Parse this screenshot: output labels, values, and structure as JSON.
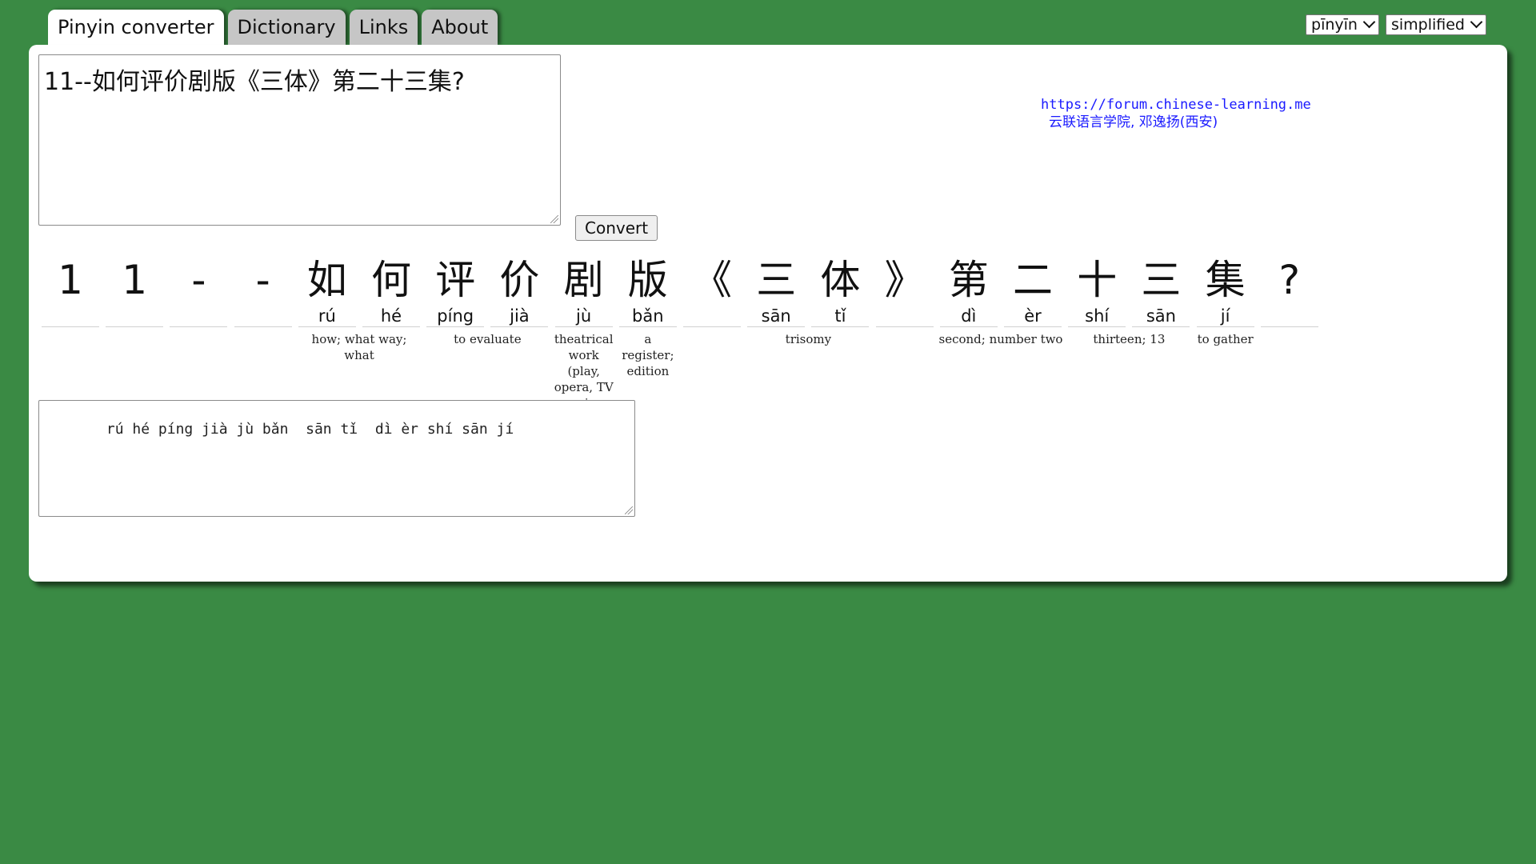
{
  "tabs": [
    {
      "label": "Pinyin converter",
      "active": true
    },
    {
      "label": "Dictionary",
      "active": false
    },
    {
      "label": "Links",
      "active": false
    },
    {
      "label": "About",
      "active": false
    }
  ],
  "selects": {
    "mode": "pīnyīn",
    "script": "simplified"
  },
  "input_text": "11--如何评价剧版《三体》第二十三集?",
  "convert_label": "Convert",
  "credit": {
    "url": "https://forum.chinese-learning.me",
    "org": "云联语言学院, 邓逸扬(西安)"
  },
  "chars": [
    {
      "hanzi": "1",
      "pinyin": ""
    },
    {
      "hanzi": "1",
      "pinyin": ""
    },
    {
      "hanzi": "-",
      "pinyin": ""
    },
    {
      "hanzi": "-",
      "pinyin": ""
    },
    {
      "hanzi": "如",
      "pinyin": "rú"
    },
    {
      "hanzi": "何",
      "pinyin": "hé"
    },
    {
      "hanzi": "评",
      "pinyin": "píng"
    },
    {
      "hanzi": "价",
      "pinyin": "jià"
    },
    {
      "hanzi": "剧",
      "pinyin": "jù"
    },
    {
      "hanzi": "版",
      "pinyin": "bǎn"
    },
    {
      "hanzi": "《",
      "pinyin": ""
    },
    {
      "hanzi": "三",
      "pinyin": "sān"
    },
    {
      "hanzi": "体",
      "pinyin": "tǐ"
    },
    {
      "hanzi": "》",
      "pinyin": ""
    },
    {
      "hanzi": "第",
      "pinyin": "dì"
    },
    {
      "hanzi": "二",
      "pinyin": "èr"
    },
    {
      "hanzi": "十",
      "pinyin": "shí"
    },
    {
      "hanzi": "三",
      "pinyin": "sān"
    },
    {
      "hanzi": "集",
      "pinyin": "jí"
    },
    {
      "hanzi": "?",
      "pinyin": ""
    }
  ],
  "definitions": [
    {
      "start": 4,
      "span": 2,
      "text": "how; what way; what"
    },
    {
      "start": 6,
      "span": 2,
      "text": "to evaluate"
    },
    {
      "start": 8,
      "span": 1,
      "text": "theatrical work (play, opera, TV series etc)"
    },
    {
      "start": 9,
      "span": 1,
      "text": "a register; edition"
    },
    {
      "start": 11,
      "span": 2,
      "text": "trisomy"
    },
    {
      "start": 14,
      "span": 2,
      "text": "second; number two"
    },
    {
      "start": 16,
      "span": 2,
      "text": "thirteen; 13"
    },
    {
      "start": 18,
      "span": 1,
      "text": "to gather"
    }
  ],
  "output_text": "   rú hé píng jià jù bǎn  sān tǐ  dì èr shí sān jí"
}
